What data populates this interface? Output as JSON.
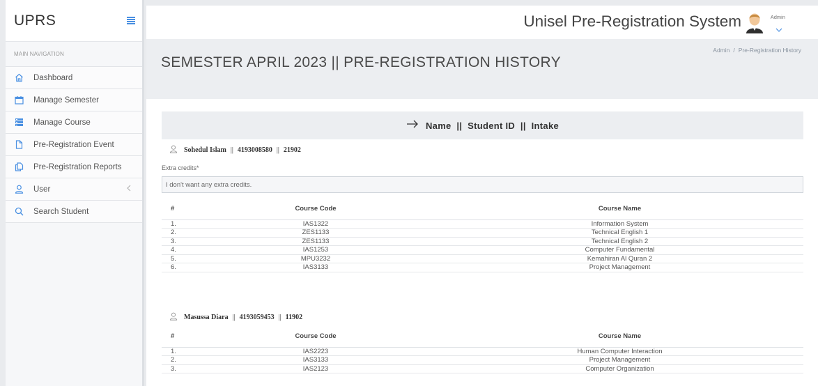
{
  "app": {
    "brand": "UPRS",
    "system_title": "Unisel Pre-Registration System",
    "user": "Admin"
  },
  "sidebar": {
    "heading": "MAIN NAVIGATION",
    "items": [
      {
        "label": "Dashboard",
        "icon": "home-icon"
      },
      {
        "label": "Manage Semester",
        "icon": "calendar-icon"
      },
      {
        "label": "Manage Course",
        "icon": "server-icon"
      },
      {
        "label": "Pre-Registration Event",
        "icon": "file-icon"
      },
      {
        "label": "Pre-Registration Reports",
        "icon": "files-icon"
      },
      {
        "label": "User",
        "icon": "user-icon"
      },
      {
        "label": "Search Student",
        "icon": "search-icon"
      }
    ]
  },
  "page": {
    "title": "SEMESTER APRIL 2023 || PRE-REGISTRATION HISTORY",
    "breadcrumb": [
      "Admin",
      "Pre-Registration History"
    ],
    "breadcrumb_sep": "/"
  },
  "main": {
    "banner": "Name  ||  Student ID  ||  Intake",
    "extra_credits_label": "Extra credits*",
    "extra_credits_value": "I don't want any extra credits.",
    "table_headers": {
      "index": "#",
      "code": "Course Code",
      "name": "Course Name"
    },
    "students": [
      {
        "name": "Sohedul Islam",
        "student_id": "4193008580",
        "intake": "21902",
        "sep": "||",
        "courses": [
          {
            "no": "1.",
            "code": "IAS1322",
            "name": "Information System"
          },
          {
            "no": "2.",
            "code": "ZES1133",
            "name": "Technical English 1"
          },
          {
            "no": "3.",
            "code": "ZES1133",
            "name": "Technical English 2"
          },
          {
            "no": "4.",
            "code": "IAS1253",
            "name": "Computer Fundamental"
          },
          {
            "no": "5.",
            "code": "MPU3232",
            "name": "Kemahiran Al Quran 2"
          },
          {
            "no": "6.",
            "code": "IAS3133",
            "name": "Project Management"
          }
        ]
      },
      {
        "name": "Masussa Diara",
        "student_id": "4193059453",
        "intake": "11902",
        "sep": "||",
        "courses": [
          {
            "no": "1.",
            "code": "IAS2223",
            "name": "Human Computer Interaction"
          },
          {
            "no": "2.",
            "code": "IAS3133",
            "name": "Project Management"
          },
          {
            "no": "3.",
            "code": "IAS2123",
            "name": "Computer Organization"
          }
        ]
      }
    ]
  },
  "colors": {
    "accent": "#4a90e2",
    "header_bg": "#eceef1",
    "sidebar_bg": "#f6f7f9"
  }
}
